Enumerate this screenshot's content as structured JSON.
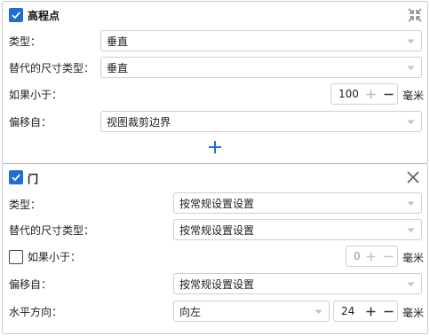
{
  "section1": {
    "title": "高程点",
    "type_label": "类型：",
    "type_value": "垂直",
    "alt_label": "替代的尺寸类型：",
    "alt_value": "垂直",
    "ifless_label": "如果小于：",
    "ifless_value": "100",
    "ifless_unit": "毫米",
    "offset_label": "偏移自：",
    "offset_value": "视图裁剪边界",
    "checked": true,
    "icons": [
      "collapse-icon",
      "add-icon"
    ]
  },
  "section2": {
    "title": "门",
    "type_label": "类型：",
    "type_value": "按常规设置设置",
    "alt_label": "替代的尺寸类型：",
    "alt_value": "按常规设置设置",
    "ifless_label": "如果小于：",
    "ifless_value": "0",
    "ifless_unit": "毫米",
    "ifless_checked": false,
    "offset_label": "偏移自：",
    "offset_value": "按常规设置设置",
    "hdir_label": "水平方向：",
    "hdir_value": "向左",
    "hdir_num": "24",
    "hdir_unit": "毫米",
    "checked": true,
    "icons": [
      "close-icon"
    ]
  },
  "colors": {
    "accent": "#1e6fd0",
    "border": "#cfcfcf"
  }
}
